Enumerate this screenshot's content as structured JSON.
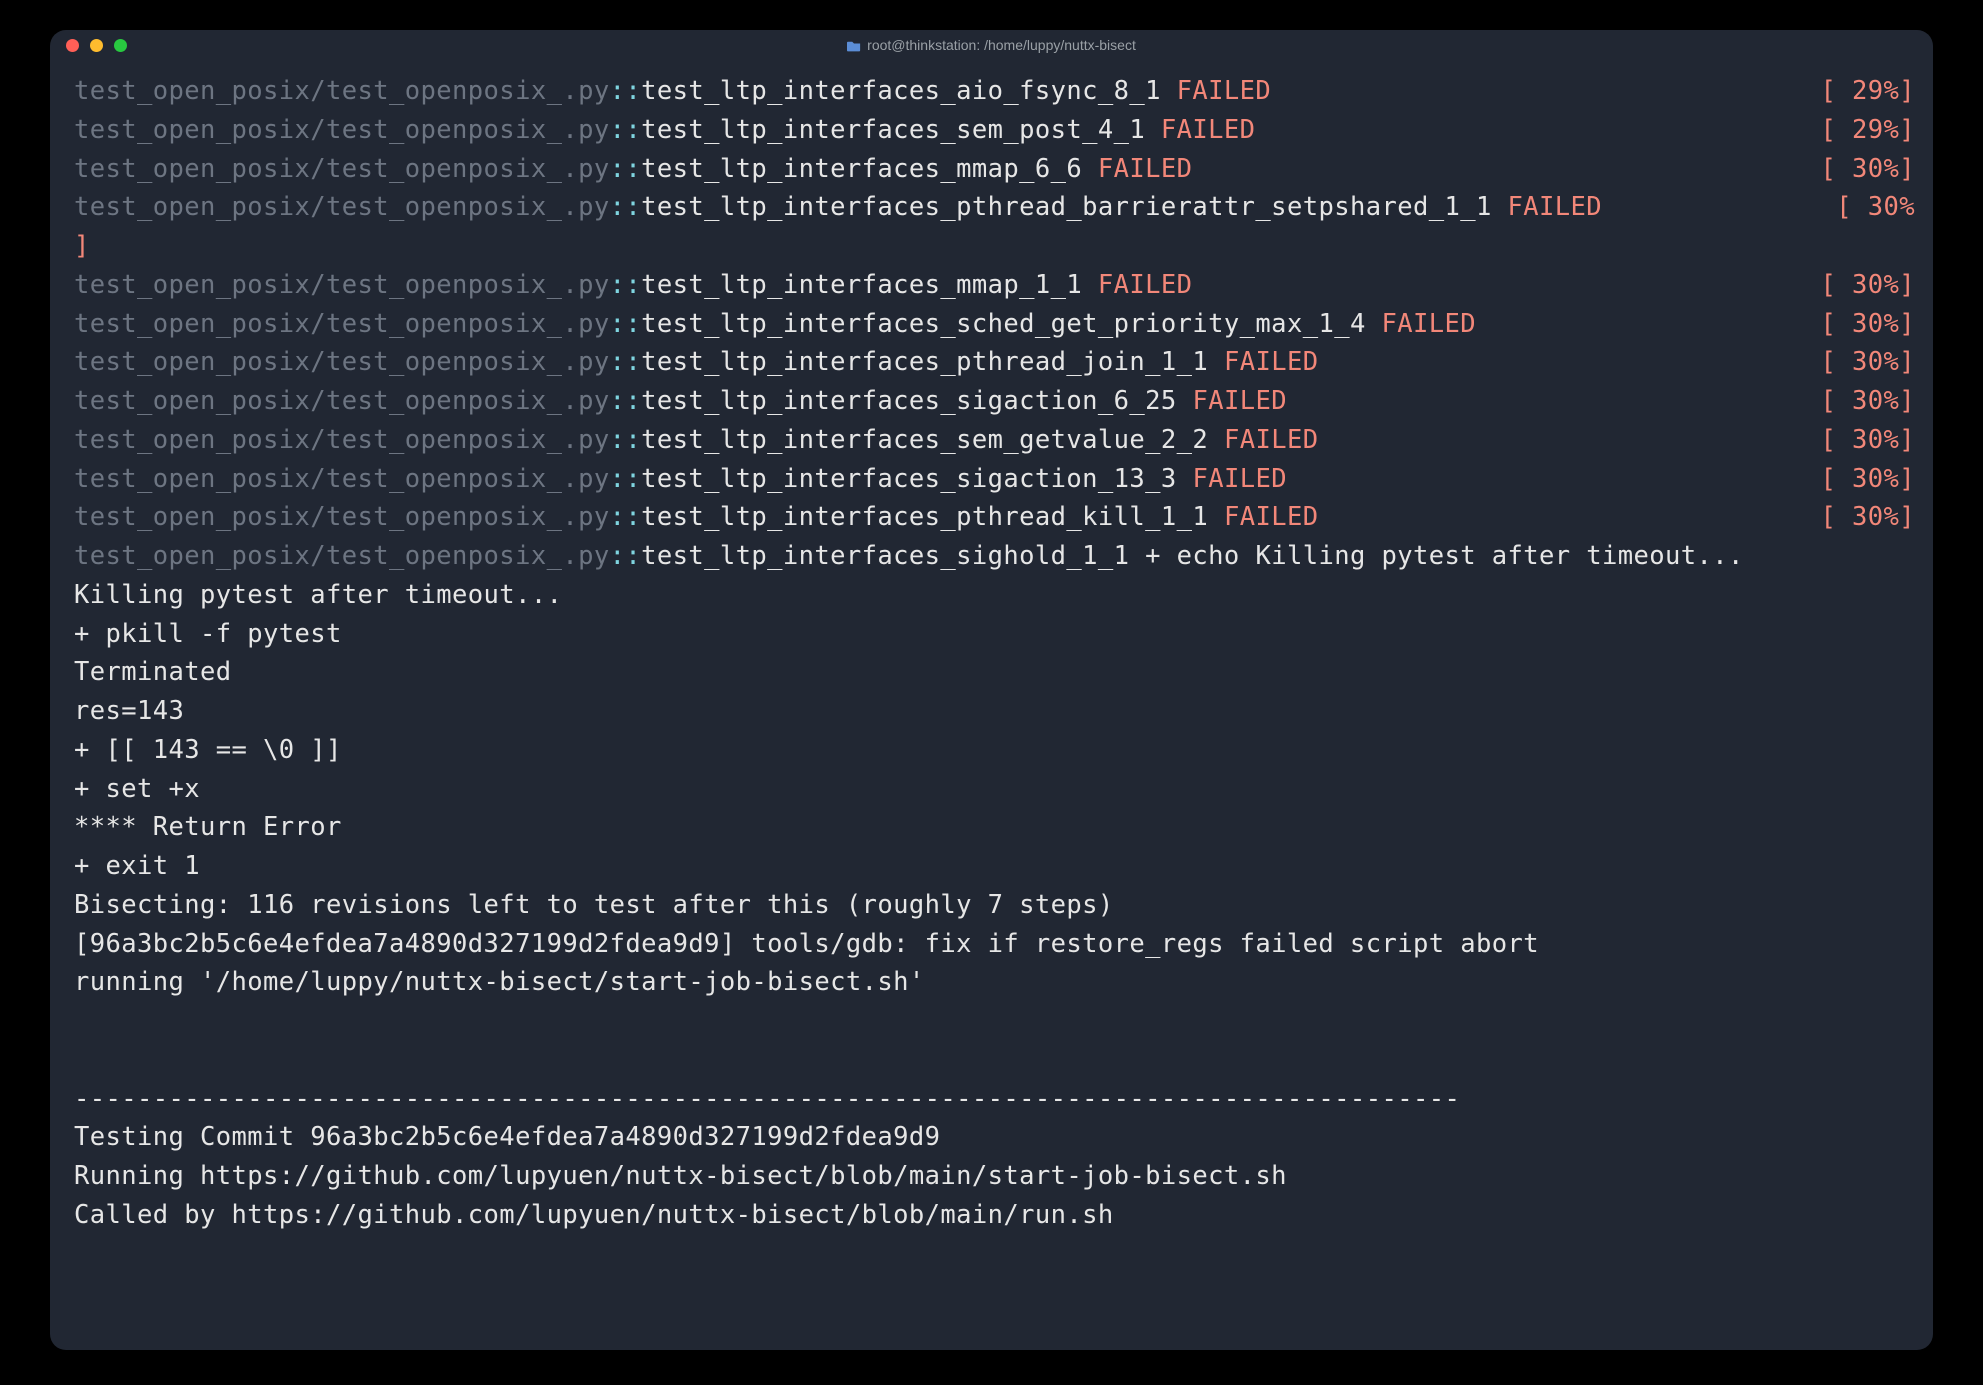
{
  "window": {
    "title": "root@thinkstation: /home/luppy/nuttx-bisect"
  },
  "tests": [
    {
      "file": "test_open_posix/test_openposix_.py",
      "sep": "::",
      "name": "test_ltp_interfaces_aio_fsync_8_1",
      "status": "FAILED",
      "pct": "[ 29%]",
      "wrap": false
    },
    {
      "file": "test_open_posix/test_openposix_.py",
      "sep": "::",
      "name": "test_ltp_interfaces_sem_post_4_1",
      "status": "FAILED",
      "pct": "[ 29%]",
      "wrap": false
    },
    {
      "file": "test_open_posix/test_openposix_.py",
      "sep": "::",
      "name": "test_ltp_interfaces_mmap_6_6",
      "status": "FAILED",
      "pct": "[ 30%]",
      "wrap": false
    },
    {
      "file": "test_open_posix/test_openposix_.py",
      "sep": "::",
      "name": "test_ltp_interfaces_pthread_barrierattr_setpshared_1_1",
      "status": "FAILED",
      "pct": "[ 30%]",
      "wrap": true
    },
    {
      "file": "test_open_posix/test_openposix_.py",
      "sep": "::",
      "name": "test_ltp_interfaces_mmap_1_1",
      "status": "FAILED",
      "pct": "[ 30%]",
      "wrap": false
    },
    {
      "file": "test_open_posix/test_openposix_.py",
      "sep": "::",
      "name": "test_ltp_interfaces_sched_get_priority_max_1_4",
      "status": "FAILED",
      "pct": "[ 30%]",
      "wrap": false
    },
    {
      "file": "test_open_posix/test_openposix_.py",
      "sep": "::",
      "name": "test_ltp_interfaces_pthread_join_1_1",
      "status": "FAILED",
      "pct": "[ 30%]",
      "wrap": false
    },
    {
      "file": "test_open_posix/test_openposix_.py",
      "sep": "::",
      "name": "test_ltp_interfaces_sigaction_6_25",
      "status": "FAILED",
      "pct": "[ 30%]",
      "wrap": false
    },
    {
      "file": "test_open_posix/test_openposix_.py",
      "sep": "::",
      "name": "test_ltp_interfaces_sem_getvalue_2_2",
      "status": "FAILED",
      "pct": "[ 30%]",
      "wrap": false
    },
    {
      "file": "test_open_posix/test_openposix_.py",
      "sep": "::",
      "name": "test_ltp_interfaces_sigaction_13_3",
      "status": "FAILED",
      "pct": "[ 30%]",
      "wrap": false
    },
    {
      "file": "test_open_posix/test_openposix_.py",
      "sep": "::",
      "name": "test_ltp_interfaces_pthread_kill_1_1",
      "status": "FAILED",
      "pct": "[ 30%]",
      "wrap": false
    }
  ],
  "lastTest": {
    "file": "test_open_posix/test_openposix_.py",
    "sep": "::",
    "name": "test_ltp_interfaces_sighold_1_1",
    "tail": " + echo Killing pytest after timeout..."
  },
  "body": [
    "Killing pytest after timeout...",
    "+ pkill -f pytest",
    "Terminated",
    "res=143",
    "+ [[ 143 == \\0 ]]",
    "+ set +x",
    "**** Return Error",
    "+ exit 1",
    "Bisecting: 116 revisions left to test after this (roughly 7 steps)",
    "[96a3bc2b5c6e4efdea7a4890d327199d2fdea9d9] tools/gdb: fix if restore_regs failed script abort",
    "running '/home/luppy/nuttx-bisect/start-job-bisect.sh'",
    "",
    "",
    "----------------------------------------------------------------------------------------",
    "Testing Commit 96a3bc2b5c6e4efdea7a4890d327199d2fdea9d9",
    "Running https://github.com/lupyuen/nuttx-bisect/blob/main/start-job-bisect.sh",
    "Called by https://github.com/lupyuen/nuttx-bisect/blob/main/run.sh"
  ]
}
